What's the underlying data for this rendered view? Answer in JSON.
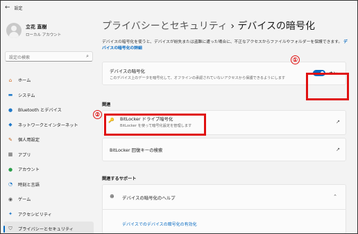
{
  "window": {
    "title": "設定"
  },
  "profile": {
    "name": "立花 直樹",
    "account_type": "ローカル アカウント"
  },
  "search": {
    "placeholder": "設定の検索"
  },
  "sidebar": {
    "items": [
      {
        "label": "ホーム",
        "icon": "home-icon"
      },
      {
        "label": "システム",
        "icon": "system-icon"
      },
      {
        "label": "Bluetooth とデバイス",
        "icon": "bluetooth-icon"
      },
      {
        "label": "ネットワークとインターネット",
        "icon": "network-icon"
      },
      {
        "label": "個人用設定",
        "icon": "brush-icon"
      },
      {
        "label": "アプリ",
        "icon": "apps-icon"
      },
      {
        "label": "アカウント",
        "icon": "account-icon"
      },
      {
        "label": "時刻と言語",
        "icon": "clock-globe-icon"
      },
      {
        "label": "ゲーム",
        "icon": "gamepad-icon"
      },
      {
        "label": "アクセシビリティ",
        "icon": "accessibility-icon"
      },
      {
        "label": "プライバシーとセキュリティ",
        "icon": "shield-icon",
        "active": true
      }
    ]
  },
  "header": {
    "breadcrumb_parent": "プライバシーとセキュリティ",
    "separator": "›",
    "title": "デバイスの暗号化"
  },
  "description": {
    "text": "デバイスの暗号化を使うと、デバイスが紛失または盗難に遭った場合に、不正なアクセスからファイルやフォルダーを保護できます。",
    "link": "デバイスの暗号化の詳細"
  },
  "encryption_card": {
    "title": "デバイスの暗号化",
    "subtitle": "このデバイス上のデータを暗号化して、オフラインの承認されていないアクセスから保護できるようにします",
    "toggle_label": "オン",
    "toggle_on": true
  },
  "related": {
    "heading": "関連",
    "bitlocker": {
      "title": "BitLocker ドライブ暗号化",
      "subtitle": "BitLocker を使って暗号化設定を管理します"
    },
    "recovery": {
      "title": "BitLocker 回復キーの検索"
    }
  },
  "support": {
    "heading": "関連するサポート",
    "help_title": "デバイスの暗号化のヘルプ",
    "help_link": "デバイスでのデバイスの暗号化の有効化"
  },
  "annotations": {
    "marker1": "①",
    "marker2": "②"
  },
  "colors": {
    "accent": "#0067c0",
    "highlight": "#e01010"
  }
}
